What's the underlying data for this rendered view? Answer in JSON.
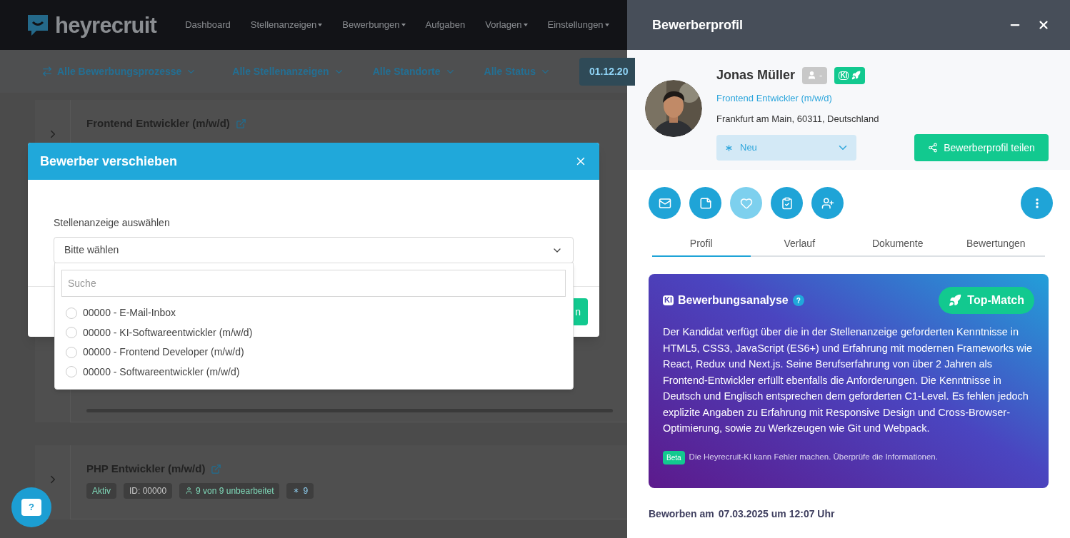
{
  "nav": {
    "logo": "heyrecruit",
    "items": [
      {
        "label": "Dashboard",
        "dropdown": false
      },
      {
        "label": "Stellenanzeigen",
        "dropdown": true
      },
      {
        "label": "Bewerbungen",
        "dropdown": true
      },
      {
        "label": "Aufgaben",
        "dropdown": false
      },
      {
        "label": "Vorlagen",
        "dropdown": true
      },
      {
        "label": "Einstellungen",
        "dropdown": true
      }
    ]
  },
  "filters": [
    {
      "label": "Alle Bewerbungsprozesse",
      "kind": "process"
    },
    {
      "label": "Alle Stellenanzeigen",
      "kind": "select"
    },
    {
      "label": "Alle Standorte",
      "kind": "select"
    },
    {
      "label": "Alle Status",
      "kind": "select"
    },
    {
      "label": "01.12.20",
      "kind": "date"
    }
  ],
  "jobs": [
    {
      "title": "Frontend Entwickler (m/w/d)"
    },
    {
      "title": "PHP Entwickler (m/w/d)",
      "badges": [
        {
          "kind": "status",
          "text": "Aktiv"
        },
        {
          "kind": "id",
          "text": "ID: 00000"
        },
        {
          "kind": "count",
          "text": "9 von 9 unbearbeitet"
        },
        {
          "kind": "new",
          "text": "9"
        }
      ]
    }
  ],
  "modal": {
    "title": "Bewerber verschieben",
    "field_label": "Stellenanzeige auswählen",
    "select_value": "Bitte wählen",
    "search_placeholder": "Suche",
    "options": [
      {
        "label": "00000 - E-Mail-Inbox",
        "selected": false
      },
      {
        "label": "00000 - KI-Softwareentwickler (m/w/d)",
        "selected": false
      },
      {
        "label": "00000 - Frontend Developer (m/w/d)",
        "selected": false
      },
      {
        "label": "00000 - Softwareentwickler (m/w/d)",
        "selected": false
      }
    ],
    "confirm_button": "n"
  },
  "help_button": "?",
  "profile": {
    "title": "Bewerberprofil",
    "name": "Jonas Müller",
    "rating_badge": "-",
    "ki_badge": "KI",
    "job": "Frontend Entwickler (m/w/d)",
    "location": "Frankfurt am Main, 60311, Deutschland",
    "status": "Neu",
    "share_button": "Bewerberprofil teilen",
    "actions": [
      {
        "kind": "email",
        "disabled": false
      },
      {
        "kind": "notes",
        "disabled": false
      },
      {
        "kind": "favorite",
        "disabled": true
      },
      {
        "kind": "tasks",
        "disabled": false
      },
      {
        "kind": "add-user",
        "disabled": false
      }
    ],
    "tabs": [
      {
        "label": "Profil",
        "selected": true
      },
      {
        "label": "Verlauf",
        "selected": false
      },
      {
        "label": "Dokumente",
        "selected": false
      },
      {
        "label": "Bewertungen",
        "selected": false
      }
    ],
    "analysis": {
      "logo": "KI",
      "title": "Bewerbungsanalyse",
      "help": "?",
      "match": "Top-Match",
      "text": "Der Kandidat verfügt über die in der Stellenanzeige geforderten Kenntnisse in HTML5, CSS3, JavaScript (ES6+) und Erfahrung mit modernen Frameworks wie React, Redux und Next.js. Seine Berufserfahrung von über 2 Jahren als Frontend-Entwickler erfüllt ebenfalls die Anforderungen. Die Kenntnisse in Deutsch und Englisch entsprechen dem geforderten C1-Level. Es fehlen jedoch explizite Angaben zu Erfahrung mit Responsive Design und Cross-Browser-Optimierung, sowie zu Werkzeugen wie Git und Webpack.",
      "beta": "Beta",
      "disclaimer": "Die Heyrecruit-KI kann Fehler machen. Überprüfe die Informationen."
    },
    "applied_label": "Beworben am",
    "applied_value": "07.03.2025 um 12:07 Uhr"
  }
}
